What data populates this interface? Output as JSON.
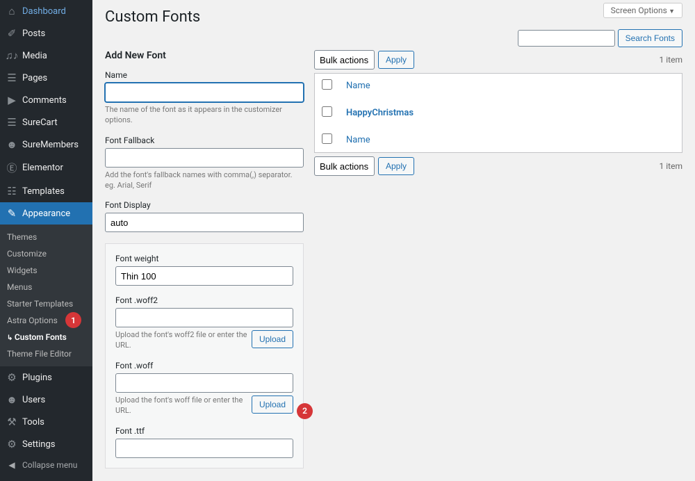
{
  "header": {
    "title": "Custom Fonts",
    "screen_options": "Screen Options"
  },
  "search": {
    "button": "Search Fonts"
  },
  "sidebar": [
    {
      "label": "Dashboard",
      "icon": "dash"
    },
    {
      "label": "Posts",
      "icon": "pin"
    },
    {
      "label": "Media",
      "icon": "media"
    },
    {
      "label": "Pages",
      "icon": "page"
    },
    {
      "label": "Comments",
      "icon": "comment"
    },
    {
      "label": "SureCart",
      "icon": "cart"
    },
    {
      "label": "SureMembers",
      "icon": "members"
    },
    {
      "label": "Elementor",
      "icon": "elementor"
    },
    {
      "label": "Templates",
      "icon": "templates"
    },
    {
      "label": "Appearance",
      "icon": "appearance",
      "active": true
    },
    {
      "label": "Plugins",
      "icon": "plugin"
    },
    {
      "label": "Users",
      "icon": "users"
    },
    {
      "label": "Tools",
      "icon": "tools"
    },
    {
      "label": "Settings",
      "icon": "settings"
    }
  ],
  "submenu": [
    "Themes",
    "Customize",
    "Widgets",
    "Menus",
    "Starter Templates",
    "Astra Options",
    "Custom Fonts",
    "Theme File Editor"
  ],
  "collapse": "Collapse menu",
  "add_form": {
    "heading": "Add New Font",
    "name_label": "Name",
    "name_help": "The name of the font as it appears in the customizer options.",
    "fallback_label": "Font Fallback",
    "fallback_help": "Add the font's fallback names with comma(,) separator. eg. Arial, Serif",
    "display_label": "Font Display",
    "display_value": "auto",
    "weight_label": "Font weight",
    "weight_value": "Thin 100",
    "woff2_label": "Font .woff2",
    "woff2_help": "Upload the font's woff2 file or enter the URL.",
    "woff_label": "Font .woff",
    "woff_help": "Upload the font's woff file or enter the URL.",
    "ttf_label": "Font .ttf",
    "upload_btn": "Upload"
  },
  "list": {
    "bulk_label": "Bulk actions",
    "apply": "Apply",
    "count": "1 item",
    "col_name": "Name",
    "rows": [
      {
        "title": "HappyChristmas"
      }
    ]
  },
  "annotations": {
    "one": "1",
    "two": "2"
  }
}
